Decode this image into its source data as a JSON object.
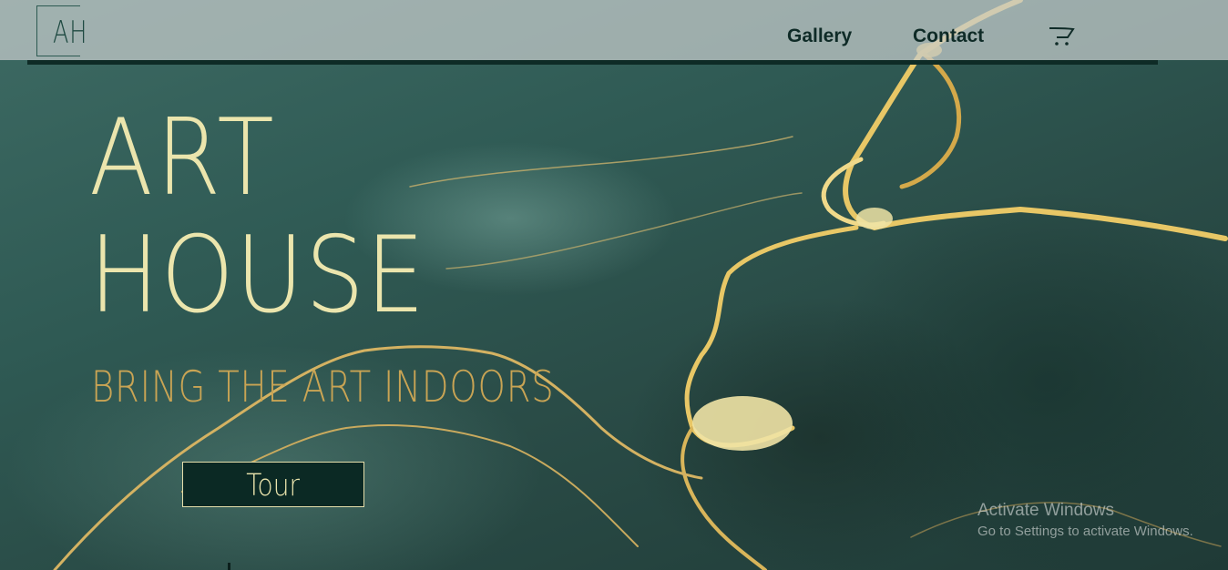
{
  "header": {
    "logo_text": "AH",
    "nav": [
      {
        "label": "Gallery"
      },
      {
        "label": "Contact"
      }
    ],
    "cart_icon": "cart-icon"
  },
  "hero": {
    "title_line1": "ART",
    "title_line2": "HOUSE",
    "tagline": "BRING THE ART INDOORS",
    "cta_label": "Tour"
  },
  "watermark": {
    "title": "Activate Windows",
    "subtitle": "Go to Settings to activate Windows."
  },
  "colors": {
    "background": "#2f5550",
    "header_line": "#0e2b26",
    "title": "#ebe5ad",
    "tagline": "#c9a454",
    "button_bg": "#0b2924",
    "gold": "#e8c766"
  }
}
